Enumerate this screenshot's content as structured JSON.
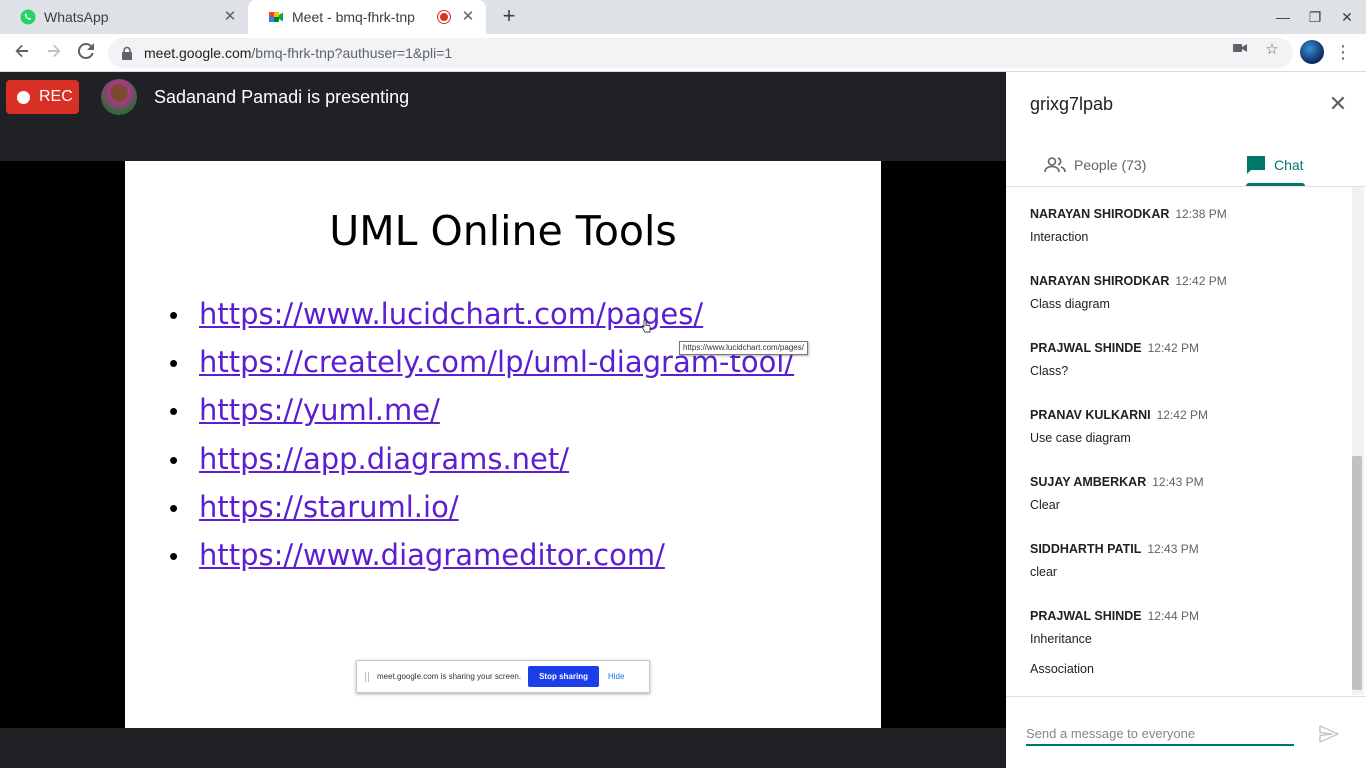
{
  "browser": {
    "tabs": [
      {
        "title": "WhatsApp",
        "icon": "whatsapp-icon",
        "active": false
      },
      {
        "title": "Meet - bmq-fhrk-tnp",
        "icon": "meet-icon",
        "active": true,
        "recording": true
      }
    ],
    "url_host": "meet.google.com",
    "url_path": "/bmq-fhrk-tnp?authuser=1&pli=1"
  },
  "meeting": {
    "rec_label": "REC",
    "presenting_text": "Sadanand Pamadi is presenting"
  },
  "slide": {
    "title": "UML Online Tools",
    "links": [
      "https://www.lucidchart.com/pages/",
      "https://creately.com/lp/uml-diagram-tool/",
      "https://yuml.me/",
      "https://app.diagrams.net/",
      "https://staruml.io/",
      "https://www.diagrameditor.com/"
    ],
    "tooltip": "https://www.lucidchart.com/pages/",
    "sharing_message": "meet.google.com is sharing your screen.",
    "stop_sharing": "Stop sharing",
    "hide": "Hide"
  },
  "panel": {
    "meeting_code": "grixg7lpab",
    "tab_people": "People (73)",
    "tab_chat": "Chat",
    "messages": [
      {
        "sender": "NARAYAN SHIRODKAR",
        "time": "12:38 PM",
        "texts": [
          "Interaction"
        ]
      },
      {
        "sender": "NARAYAN SHIRODKAR",
        "time": "12:42 PM",
        "texts": [
          "Class diagram"
        ]
      },
      {
        "sender": "PRAJWAL SHINDE",
        "time": "12:42 PM",
        "texts": [
          "Class?"
        ]
      },
      {
        "sender": "PRANAV KULKARNI",
        "time": "12:42 PM",
        "texts": [
          "Use case diagram"
        ]
      },
      {
        "sender": "SUJAY AMBERKAR",
        "time": "12:43 PM",
        "texts": [
          "Clear"
        ]
      },
      {
        "sender": "SIDDHARTH PATIL",
        "time": "12:43 PM",
        "texts": [
          "clear"
        ]
      },
      {
        "sender": "PRAJWAL SHINDE",
        "time": "12:44 PM",
        "texts": [
          "Inheritance",
          "Association"
        ]
      }
    ],
    "composer_placeholder": "Send a message to everyone"
  },
  "colors": {
    "accent": "#00796b",
    "rec": "#d93025",
    "stage_bg": "#202124",
    "link": "#5b1fd1"
  }
}
